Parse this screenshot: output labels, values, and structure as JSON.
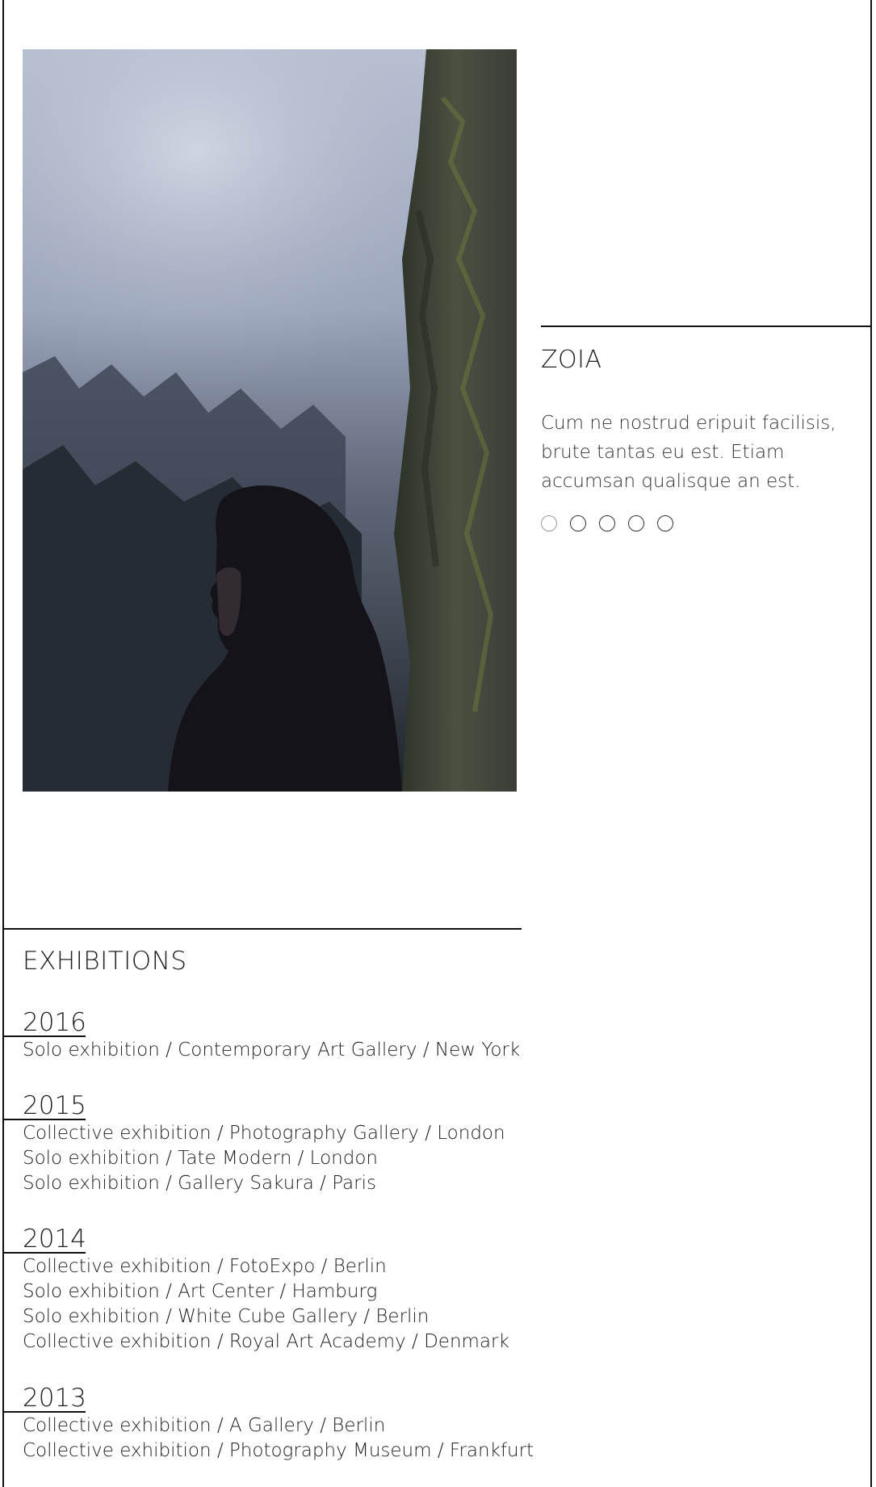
{
  "artist": {
    "name": "ZOIA",
    "bio": "Cum ne nostrud eripuit facilisis, brute tantas eu est. Etiam accumsan qualisque an est."
  },
  "carousel": {
    "dot_count": 5,
    "active_index": 0
  },
  "exhibitions": {
    "title": "EXHIBITIONS",
    "groups": [
      {
        "year": "2016",
        "entries": [
          "Solo exhibition / Contemporary Art Gallery / New York"
        ]
      },
      {
        "year": "2015",
        "entries": [
          "Collective exhibition / Photography Gallery / London",
          "Solo exhibition / Tate Modern / London",
          "Solo exhibition / Gallery Sakura / Paris"
        ]
      },
      {
        "year": "2014",
        "entries": [
          "Collective exhibition / FotoExpo / Berlin",
          "Solo exhibition / Art Center / Hamburg",
          "Solo exhibition / White Cube Gallery / Berlin",
          "Collective exhibition / Royal Art Academy / Denmark"
        ]
      },
      {
        "year": "2013",
        "entries": [
          "Collective exhibition / A Gallery / Berlin",
          "Collective exhibition / Photography Museum / Frankfurt"
        ]
      }
    ]
  },
  "colors": {
    "text": "#222222",
    "rule": "#111111",
    "background": "#ffffff"
  }
}
